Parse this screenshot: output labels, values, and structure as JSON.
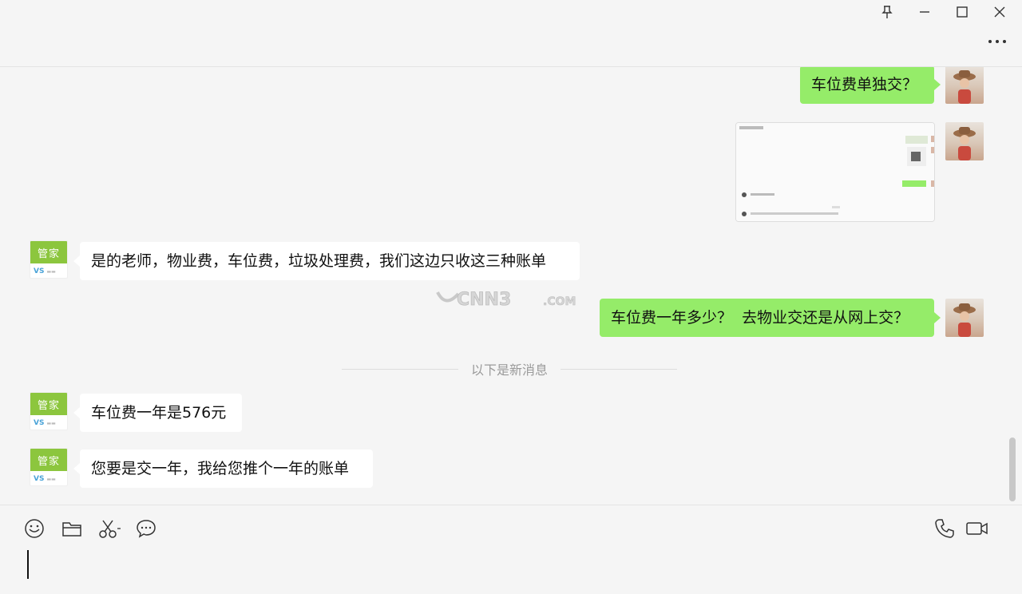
{
  "window": {
    "pin_icon": "pin-icon",
    "minimize_icon": "minimize-icon",
    "maximize_icon": "maximize-icon",
    "close_icon": "close-icon",
    "more_icon": "more-dots-icon"
  },
  "bot_avatar": {
    "top_text": "管家",
    "logo_text": "VS"
  },
  "messages": {
    "m1": "车位费单独交？",
    "m3": "是的老师，物业费，车位费，垃圾处理费，我们这边只收这三种账单",
    "m4": "车位费一年多少？  去物业交还是从网上交？",
    "divider": "以下是新消息",
    "m5": "车位费一年是576元",
    "m6": "您要是交一年，我给您推个一年的账单"
  },
  "watermark": {
    "text": "CNN3",
    "domain": ".COM"
  },
  "toolbar": {
    "emoji_icon": "emoji-icon",
    "folder_icon": "folder-icon",
    "scissors_icon": "scissors-icon",
    "chat_icon": "chat-bubble-icon",
    "phone_icon": "phone-icon",
    "video_icon": "video-icon"
  },
  "input": {
    "value": ""
  },
  "colors": {
    "my_bubble": "#95ec69",
    "their_bubble": "#ffffff",
    "background": "#f5f5f5",
    "bot_green": "#8cc63e"
  }
}
